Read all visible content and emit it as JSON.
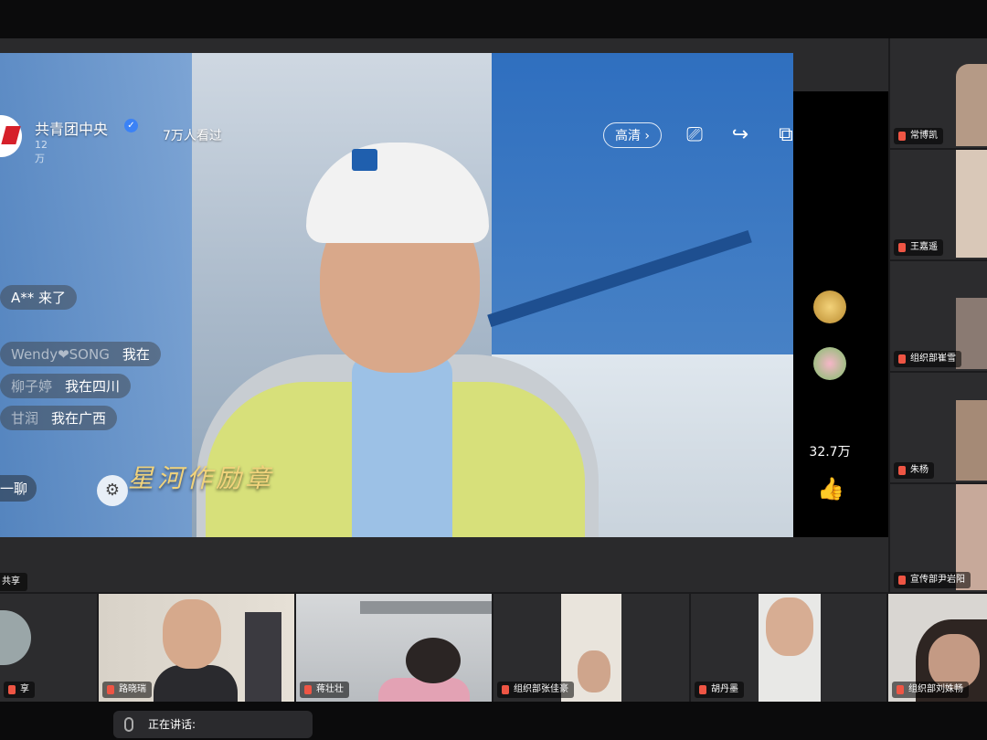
{
  "live": {
    "host_name": "共青团中央",
    "host_sub": "12万",
    "viewers": "7万人看过",
    "quality_label": "高清",
    "caption": "星河作励章",
    "likes": "32.7万",
    "chat": [
      {
        "user": "",
        "text": "A** 来了"
      },
      {
        "user": "Wendy❤SONG",
        "text": "我在"
      },
      {
        "user": "柳子婷",
        "text": "我在四川"
      },
      {
        "user": "甘润",
        "text": "我在广西"
      }
    ],
    "chat_more": "一聊"
  },
  "icons": {
    "verified": "verified-badge-icon",
    "cast": "cast-icon",
    "share": "share-icon",
    "pip": "picture-in-picture-icon",
    "close": "close-icon",
    "like": "thumbs-up-icon",
    "shop": "shop-icon",
    "mic": "microphone-icon"
  },
  "share_tag": "共享",
  "participants_right": [
    {
      "name": "常博凯"
    },
    {
      "name": "王嘉遥"
    },
    {
      "name": "组织部崔雪"
    },
    {
      "name": "朱杨"
    },
    {
      "name": "宣传部尹岩阳"
    }
  ],
  "participants_bottom": [
    {
      "name": "享"
    },
    {
      "name": "路晓瑞"
    },
    {
      "name": "蒋壮壮"
    },
    {
      "name": "组织部张佳豪"
    },
    {
      "name": "胡丹墨"
    },
    {
      "name": "组织部刘姝畅"
    }
  ],
  "status": {
    "speaking_label": "正在讲话:"
  },
  "colors": {
    "brand_red": "#d6202a",
    "accent_gold": "#f1d37c"
  }
}
